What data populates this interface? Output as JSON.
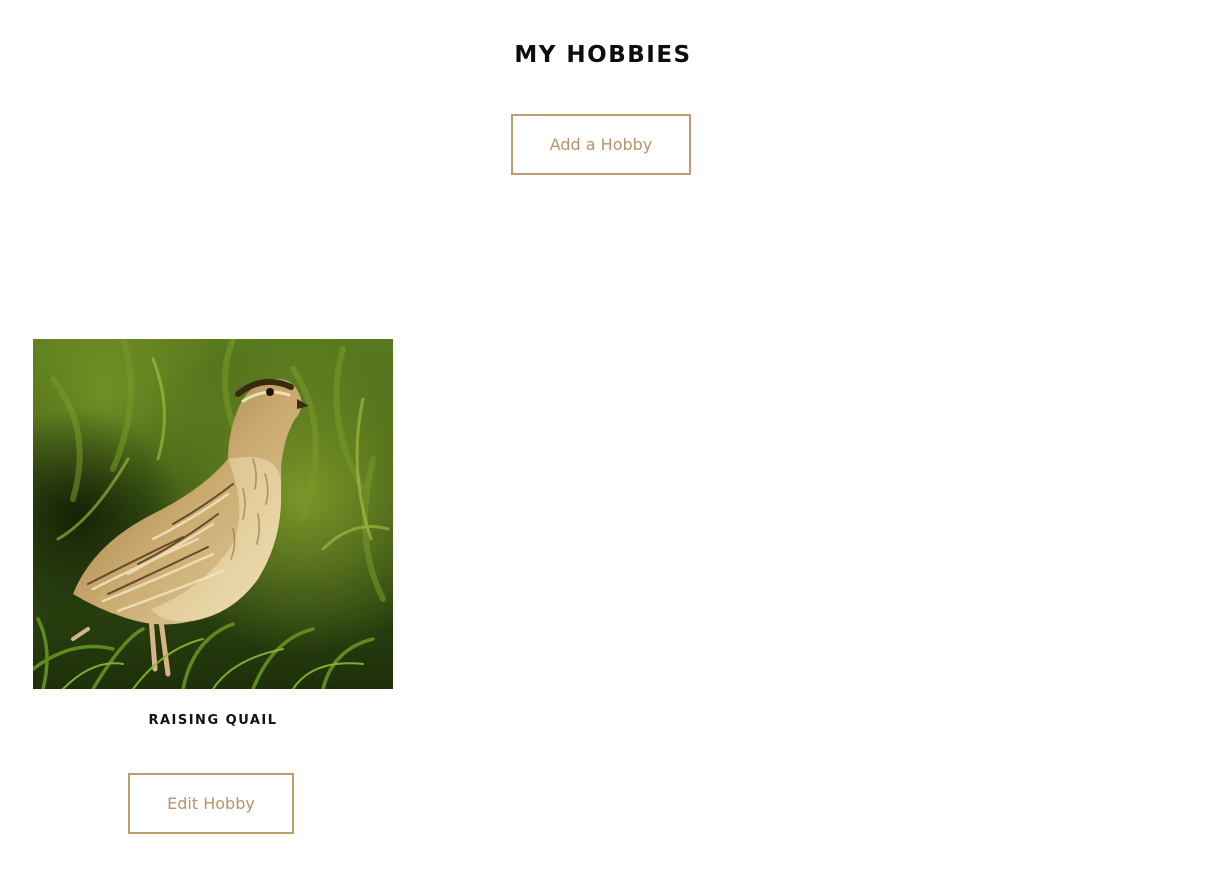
{
  "header": {
    "title": "MY HOBBIES"
  },
  "actions": {
    "add_label": "Add a Hobby"
  },
  "hobbies": [
    {
      "title": "RAISING QUAIL",
      "edit_label": "Edit Hobby",
      "image": "quail-photo"
    }
  ],
  "colors": {
    "accent": "#c19c6f",
    "accent_text": "#b8946a",
    "title_text": "#0d0d0d"
  }
}
